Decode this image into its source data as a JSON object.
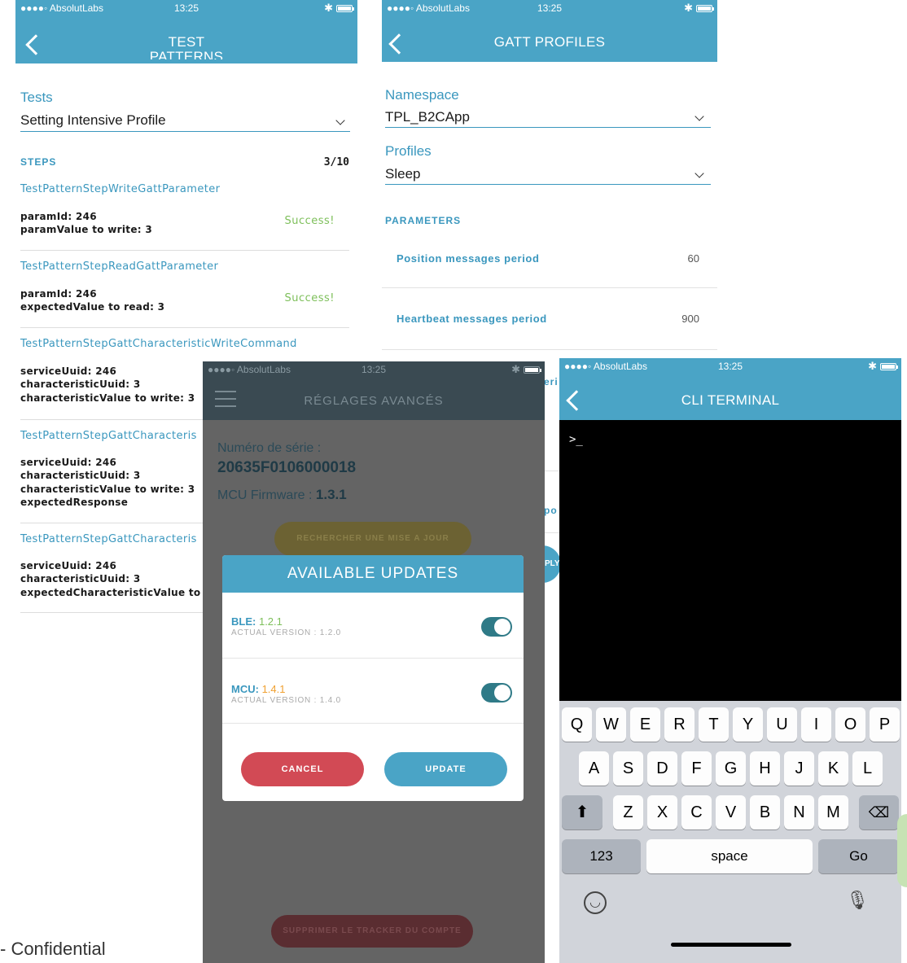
{
  "screen1": {
    "status": {
      "carrier": "●●●●◦ AbsolutLabs",
      "time": "13:25"
    },
    "title_line1": "TEST",
    "title_line2": "PATTERNS",
    "tests_label": "Tests",
    "tests_value": "Setting Intensive Profile",
    "steps_label": "STEPS",
    "steps_count": "3/10",
    "steps": [
      {
        "title": "TestPatternStepWriteGattParameter",
        "lines": [
          "paramId: 246",
          "paramValue to write: 3"
        ],
        "status": "Success!"
      },
      {
        "title": "TestPatternStepReadGattParameter",
        "lines": [
          "paramId: 246",
          "expectedValue to read: 3"
        ],
        "status": "Success!"
      },
      {
        "title": "TestPatternStepGattCharacteristicWriteCommand",
        "lines": [
          "serviceUuid: 246",
          "characteristicUuid: 3",
          "characteristicValue to write: 3"
        ]
      },
      {
        "title": "TestPatternStepGattCharacteris",
        "lines": [
          "serviceUuid: 246",
          "characteristicUuid: 3",
          "characteristicValue to write: 3",
          "expectedResponse"
        ]
      },
      {
        "title": "TestPatternStepGattCharacteris",
        "lines": [
          "serviceUuid: 246",
          "characteristicUuid: 3",
          "expectedCharacteristicValue to"
        ]
      }
    ]
  },
  "screen2": {
    "status": {
      "carrier": "●●●●◦ AbsolutLabs",
      "time": "13:25"
    },
    "title": "GATT PROFILES",
    "namespace_label": "Namespace",
    "namespace_value": "TPL_B2CApp",
    "profiles_label": "Profiles",
    "profiles_value": "Sleep",
    "parameters_label": "PARAMETERS",
    "params": [
      {
        "name": "Position messages period",
        "value": "60"
      },
      {
        "name": "Heartbeat messages period",
        "value": "900"
      }
    ],
    "partial_1": "eri",
    "partial_2": "po",
    "partial_3": "PLY"
  },
  "screen3": {
    "status": {
      "carrier": "●●●●◦ AbsolutLabs",
      "time": "13:25"
    },
    "title": "RÉGLAGES AVANCÉS",
    "serial_label": "Numéro de série :",
    "serial_value": "20635F0106000018",
    "mcu_label": "MCU Firmware :",
    "mcu_value": "1.3.1",
    "search_button": "RECHERCHER UNE MISE A JOUR",
    "delete_button": "SUPPRIMER LE TRACKER DU COMPTE",
    "dialog": {
      "title": "AVAILABLE UPDATES",
      "items": [
        {
          "name": "BLE:",
          "version": "1.2.1",
          "actual": "ACTUAL VERSION : 1.2.0",
          "version_color": "#7dbf5a"
        },
        {
          "name": "MCU:",
          "version": "1.4.1",
          "actual": "ACTUAL VERSION : 1.4.0",
          "version_color": "#f0a030"
        }
      ],
      "cancel": "CANCEL",
      "update": "UPDATE"
    }
  },
  "screen4": {
    "status": {
      "carrier": "●●●●◦ AbsolutLabs",
      "time": "13:25"
    },
    "title": "CLI TERMINAL",
    "prompt": ">_",
    "keyboard": {
      "row1": [
        "Q",
        "W",
        "E",
        "R",
        "T",
        "Y",
        "U",
        "I",
        "O",
        "P"
      ],
      "row2": [
        "A",
        "S",
        "D",
        "F",
        "G",
        "H",
        "J",
        "K",
        "L"
      ],
      "row3": [
        "Z",
        "X",
        "C",
        "V",
        "B",
        "N",
        "M"
      ],
      "numbers": "123",
      "space": "space",
      "go": "Go"
    }
  },
  "footer": "- Confidential",
  "colors": {
    "accent": "#4aa4c6",
    "cancel_red": "#d24a55",
    "toggle_on": "#2f7a87"
  }
}
